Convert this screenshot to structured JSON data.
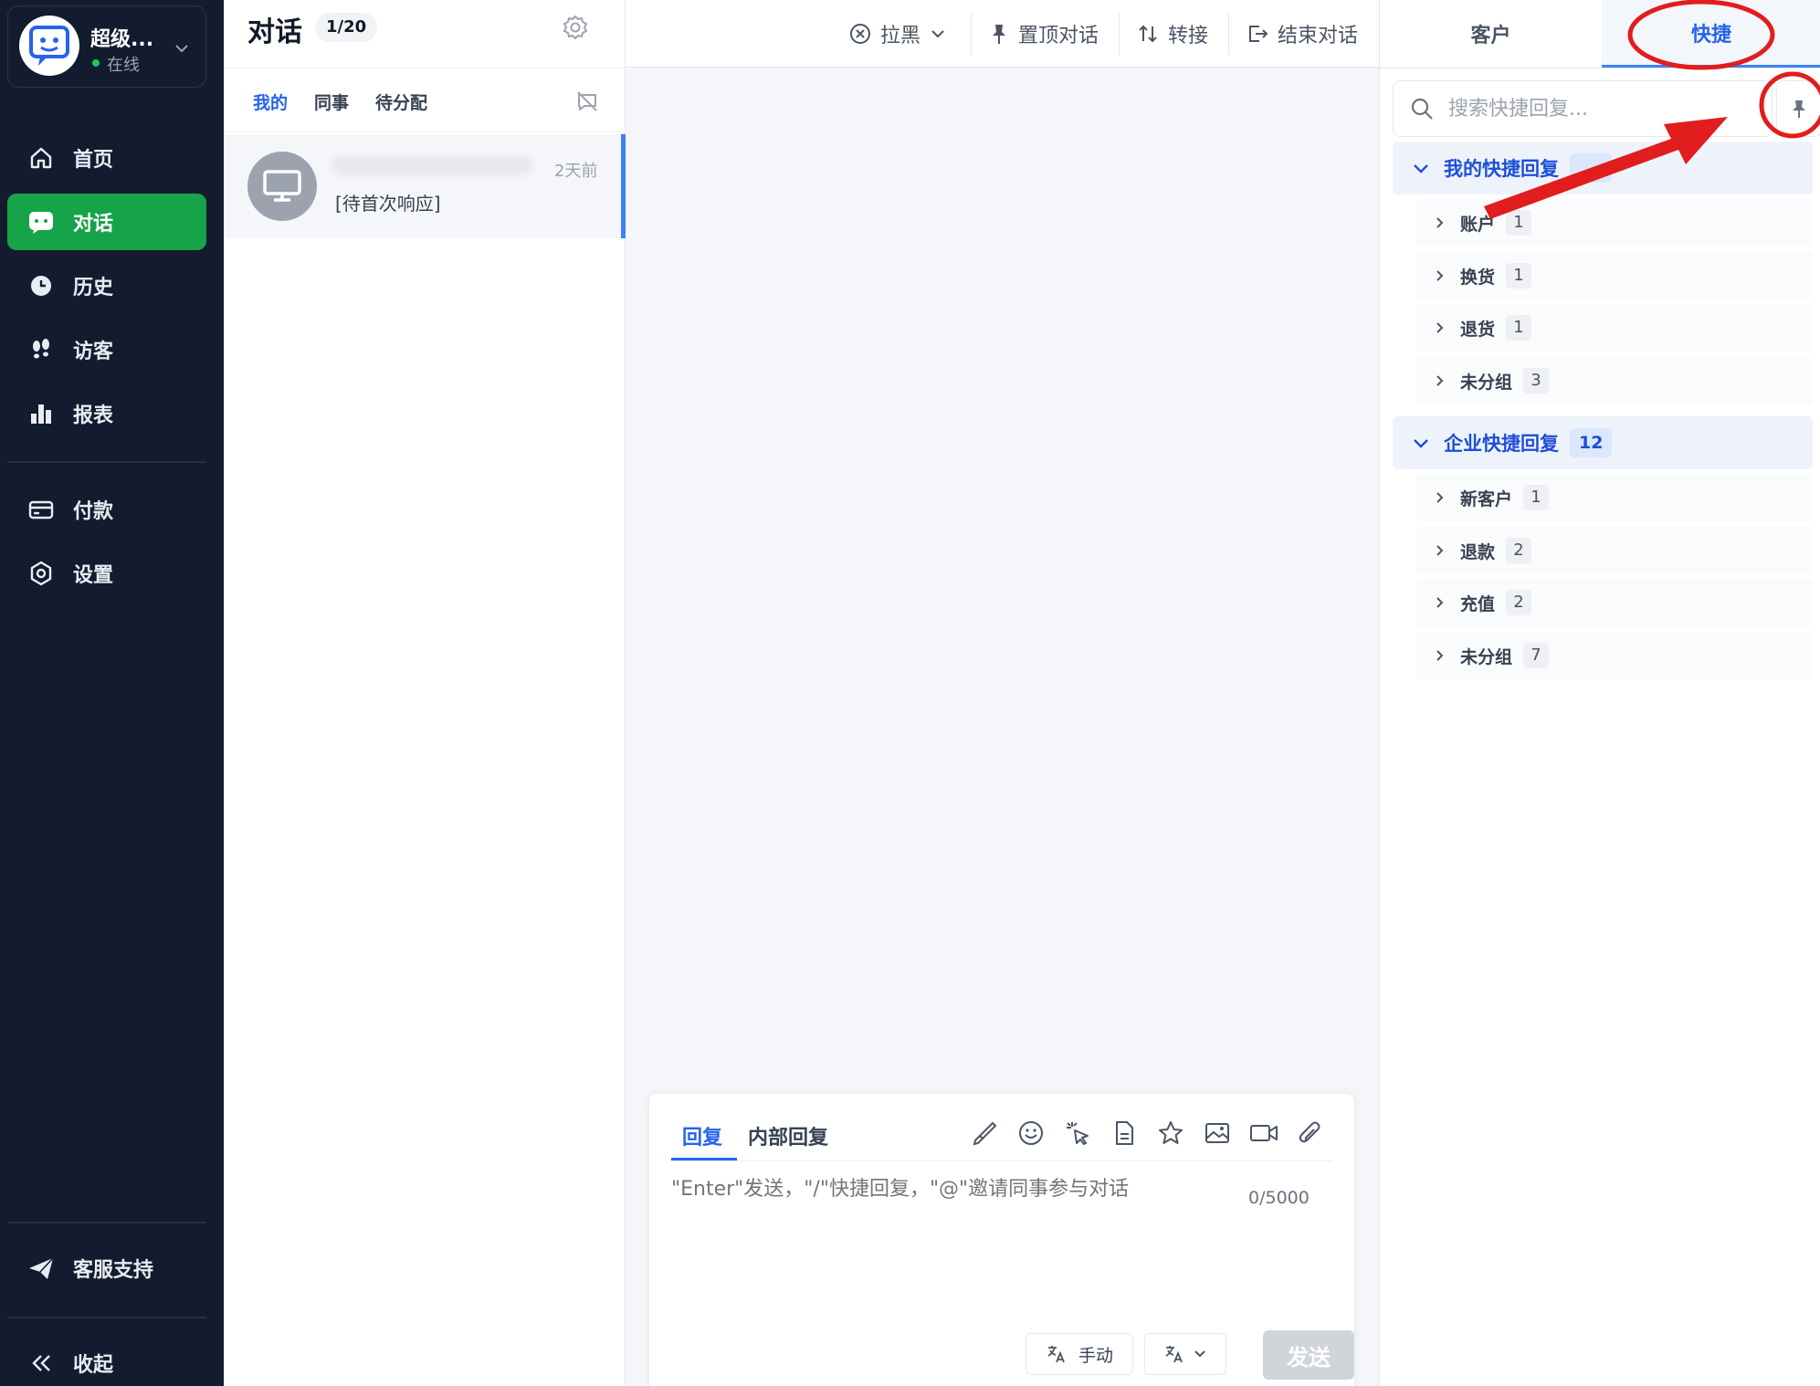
{
  "sidebar": {
    "user": {
      "name": "超级...",
      "status": "在线"
    },
    "nav_items": [
      {
        "label": "首页",
        "icon": "home-icon"
      },
      {
        "label": "对话",
        "icon": "chat-icon",
        "active": true
      },
      {
        "label": "历史",
        "icon": "history-icon"
      },
      {
        "label": "访客",
        "icon": "footprints-icon"
      },
      {
        "label": "报表",
        "icon": "bar-chart-icon"
      },
      {
        "label": "付款",
        "icon": "credit-card-icon"
      },
      {
        "label": "设置",
        "icon": "settings-icon"
      }
    ],
    "support_label": "客服支持",
    "collapse_label": "收起"
  },
  "conversations": {
    "title": "对话",
    "count": "1/20",
    "tabs": [
      {
        "label": "我的",
        "active": true
      },
      {
        "label": "同事"
      },
      {
        "label": "待分配"
      }
    ],
    "items": [
      {
        "time": "2天前",
        "preview": "[待首次响应]"
      }
    ]
  },
  "chat": {
    "toolbar": {
      "block_label": "拉黑",
      "pin_label": "置顶对话",
      "transfer_label": "转接",
      "end_label": "结束对话"
    },
    "composer": {
      "tabs": [
        {
          "label": "回复",
          "active": true
        },
        {
          "label": "内部回复"
        }
      ],
      "placeholder": "\"Enter\"发送，\"/\"快捷回复，\"@\"邀请同事参与对话",
      "counter": "0/5000",
      "manual_label": "手动",
      "send_label": "发送"
    }
  },
  "right_panel": {
    "tabs": [
      {
        "label": "客户"
      },
      {
        "label": "快捷",
        "active": true
      }
    ],
    "search_placeholder": "搜索快捷回复...",
    "groups": [
      {
        "label": "我的快捷回复",
        "count": "",
        "items": [
          {
            "label": "账户",
            "count": "1"
          },
          {
            "label": "换货",
            "count": "1"
          },
          {
            "label": "退货",
            "count": "1"
          },
          {
            "label": "未分组",
            "count": "3"
          }
        ]
      },
      {
        "label": "企业快捷回复",
        "count": "12",
        "items": [
          {
            "label": "新客户",
            "count": "1"
          },
          {
            "label": "退款",
            "count": "2"
          },
          {
            "label": "充值",
            "count": "2"
          },
          {
            "label": "未分组",
            "count": "7"
          }
        ]
      }
    ]
  },
  "colors": {
    "sidebar_bg": "#131b2e",
    "active_green": "#16a34a",
    "accent_blue": "#2563eb",
    "annotation_red": "#e11d1d"
  }
}
